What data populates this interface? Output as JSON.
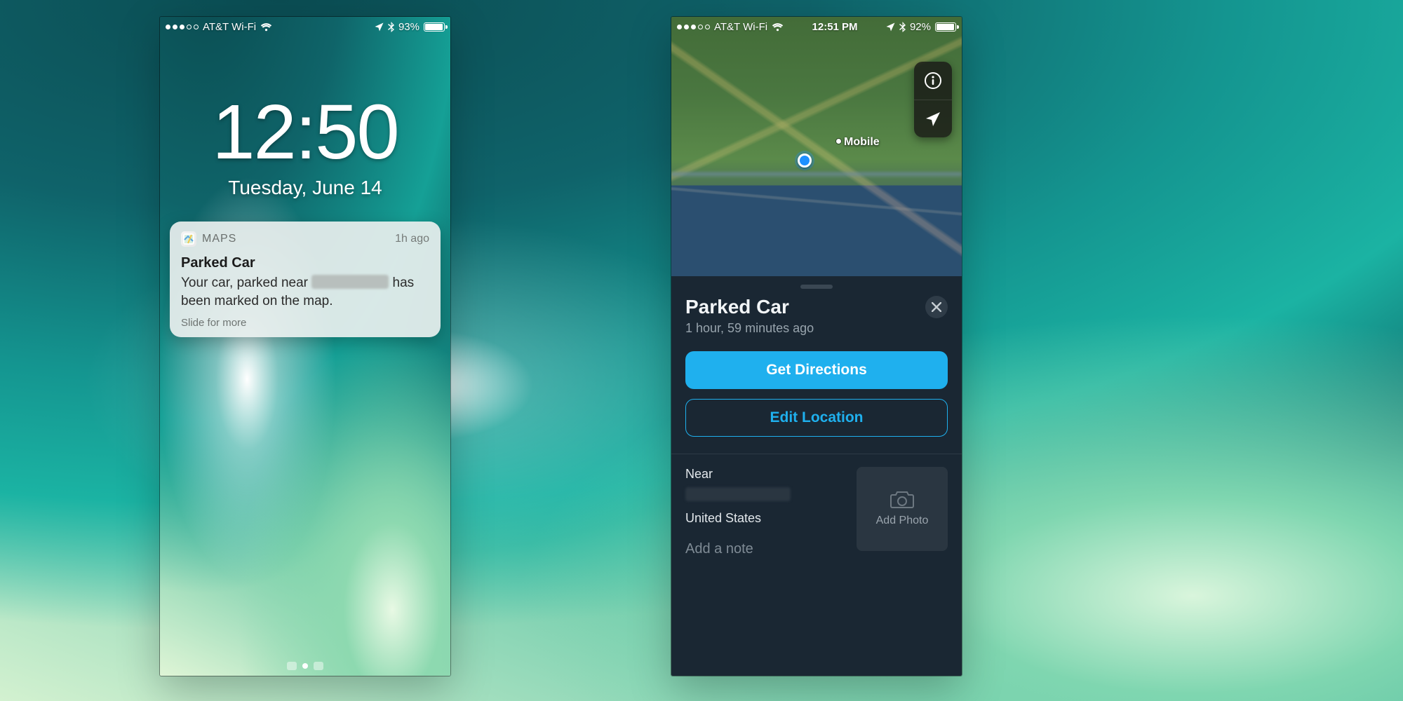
{
  "left": {
    "status": {
      "carrier": "AT&T Wi-Fi",
      "battery_pct": "93%"
    },
    "clock": {
      "time": "12:50",
      "date": "Tuesday, June 14"
    },
    "notification": {
      "app": "MAPS",
      "age": "1h ago",
      "title": "Parked Car",
      "body_prefix": "Your car, parked near ",
      "body_suffix": " has been marked on the map.",
      "hint": "Slide for more"
    }
  },
  "right": {
    "status": {
      "carrier": "AT&T Wi-Fi",
      "clock": "12:51 PM",
      "battery_pct": "92%"
    },
    "map": {
      "city_label": "Mobile"
    },
    "sheet": {
      "title": "Parked Car",
      "subtitle": "1 hour, 59 minutes ago",
      "directions_btn": "Get Directions",
      "edit_btn": "Edit Location",
      "near_label": "Near",
      "country": "United States",
      "add_photo": "Add Photo",
      "add_note": "Add a note"
    }
  }
}
